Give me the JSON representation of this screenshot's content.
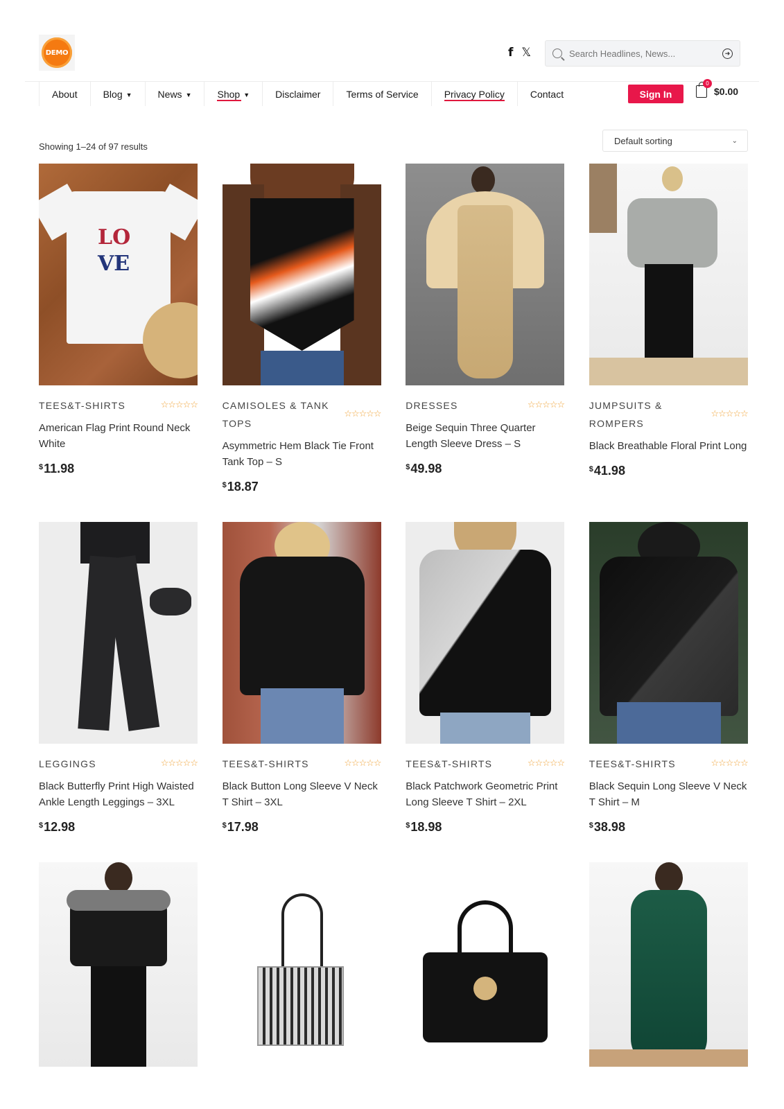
{
  "logo": {
    "text": "DEMO"
  },
  "social": {
    "facebook": "f",
    "x": "𝕏"
  },
  "search": {
    "placeholder": "Search Headlines, News..."
  },
  "nav": {
    "items": [
      {
        "label": "About",
        "has_dropdown": false
      },
      {
        "label": "Blog",
        "has_dropdown": true
      },
      {
        "label": "News",
        "has_dropdown": true
      },
      {
        "label": "Shop",
        "has_dropdown": true,
        "active": true
      },
      {
        "label": "Disclaimer",
        "has_dropdown": false
      },
      {
        "label": "Terms of Service",
        "has_dropdown": false
      },
      {
        "label": "Privacy Policy",
        "has_dropdown": false,
        "underline": true
      },
      {
        "label": "Contact",
        "has_dropdown": false
      }
    ],
    "signin_label": "Sign In",
    "cart_count": "0",
    "cart_total": "$0.00",
    "accent_color": "#e8174a"
  },
  "toolbar": {
    "results_text": "Showing 1–24 of 97 results",
    "sort_selected": "Default sorting"
  },
  "products": [
    {
      "category": "TEES&T-SHIRTS",
      "title": "American Flag Print Round Neck White",
      "currency": "$",
      "price": "11.98",
      "rating": 0
    },
    {
      "category": "CAMISOLES & TANK TOPS",
      "title": "Asymmetric Hem Black Tie Front Tank Top – S",
      "currency": "$",
      "price": "18.87",
      "rating": 0
    },
    {
      "category": "DRESSES",
      "title": "Beige Sequin Three Quarter Length Sleeve Dress – S",
      "currency": "$",
      "price": "49.98",
      "rating": 0
    },
    {
      "category": "JUMPSUITS & ROMPERS",
      "title": "Black Breathable Floral Print Long",
      "currency": "$",
      "price": "41.98",
      "rating": 0
    },
    {
      "category": "LEGGINGS",
      "title": "Black Butterfly Print High Waisted Ankle Length Leggings – 3XL",
      "currency": "$",
      "price": "12.98",
      "rating": 0
    },
    {
      "category": "TEES&T-SHIRTS",
      "title": "Black Button Long Sleeve V Neck T Shirt – 3XL",
      "currency": "$",
      "price": "17.98",
      "rating": 0
    },
    {
      "category": "TEES&T-SHIRTS",
      "title": "Black Patchwork Geometric Print Long Sleeve T Shirt – 2XL",
      "currency": "$",
      "price": "18.98",
      "rating": 0
    },
    {
      "category": "TEES&T-SHIRTS",
      "title": "Black Sequin Long Sleeve V Neck T Shirt – M",
      "currency": "$",
      "price": "38.98",
      "rating": 0
    }
  ],
  "stars_glyph": "☆☆☆☆☆",
  "chevron_glyph": "⌄"
}
